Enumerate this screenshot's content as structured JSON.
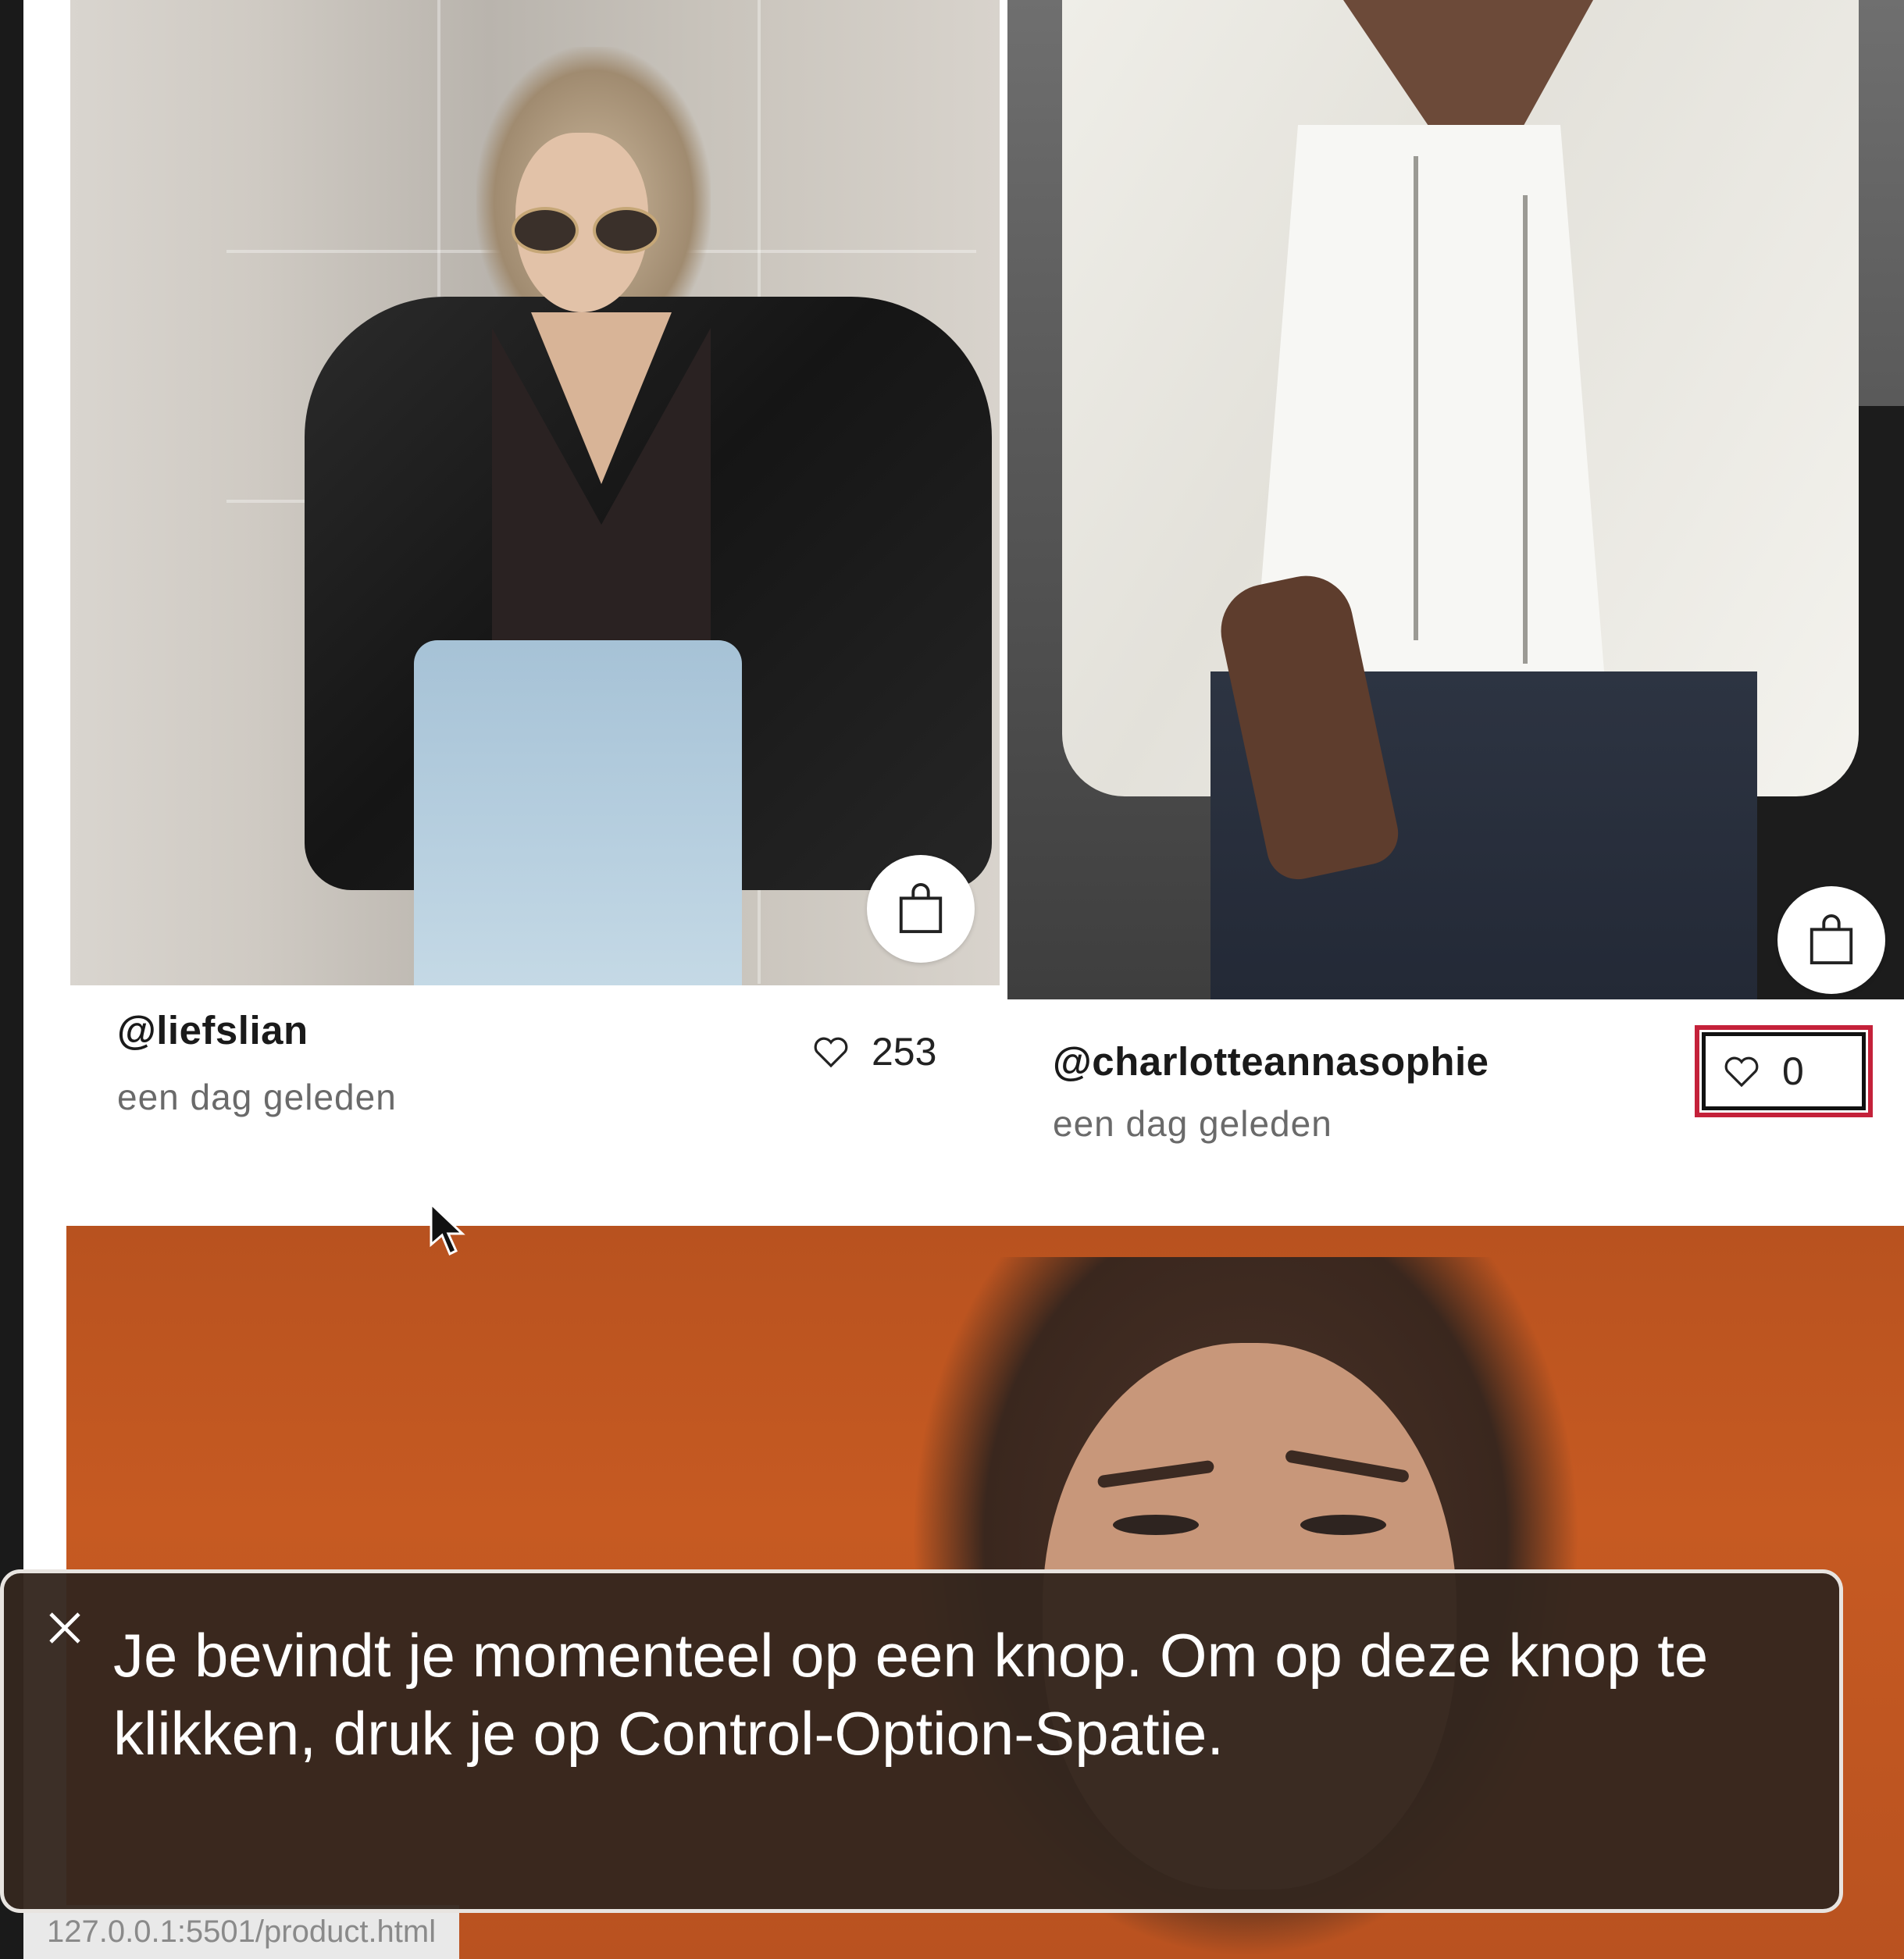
{
  "posts": [
    {
      "username": "@liefslian",
      "time": "een dag geleden",
      "likes": "253",
      "like_icon": "heart-outline-icon",
      "bag_icon": "shopping-bag-icon"
    },
    {
      "username": "@charlotteannasophie",
      "time": "een dag geleden",
      "likes": "0",
      "like_icon": "heart-outline-icon",
      "bag_icon": "shopping-bag-icon",
      "focused": true
    }
  ],
  "voiceover": {
    "text": "Je bevindt je momenteel op een knop. Om op deze knop te klikken, druk je op Control-Option-Spatie.",
    "close_icon": "close-icon"
  },
  "status_url": "127.0.0.1:5501/product.html",
  "colors": {
    "focus_ring": "#c4213a",
    "caption_bg": "#34261e",
    "banner": "#c65a22"
  }
}
